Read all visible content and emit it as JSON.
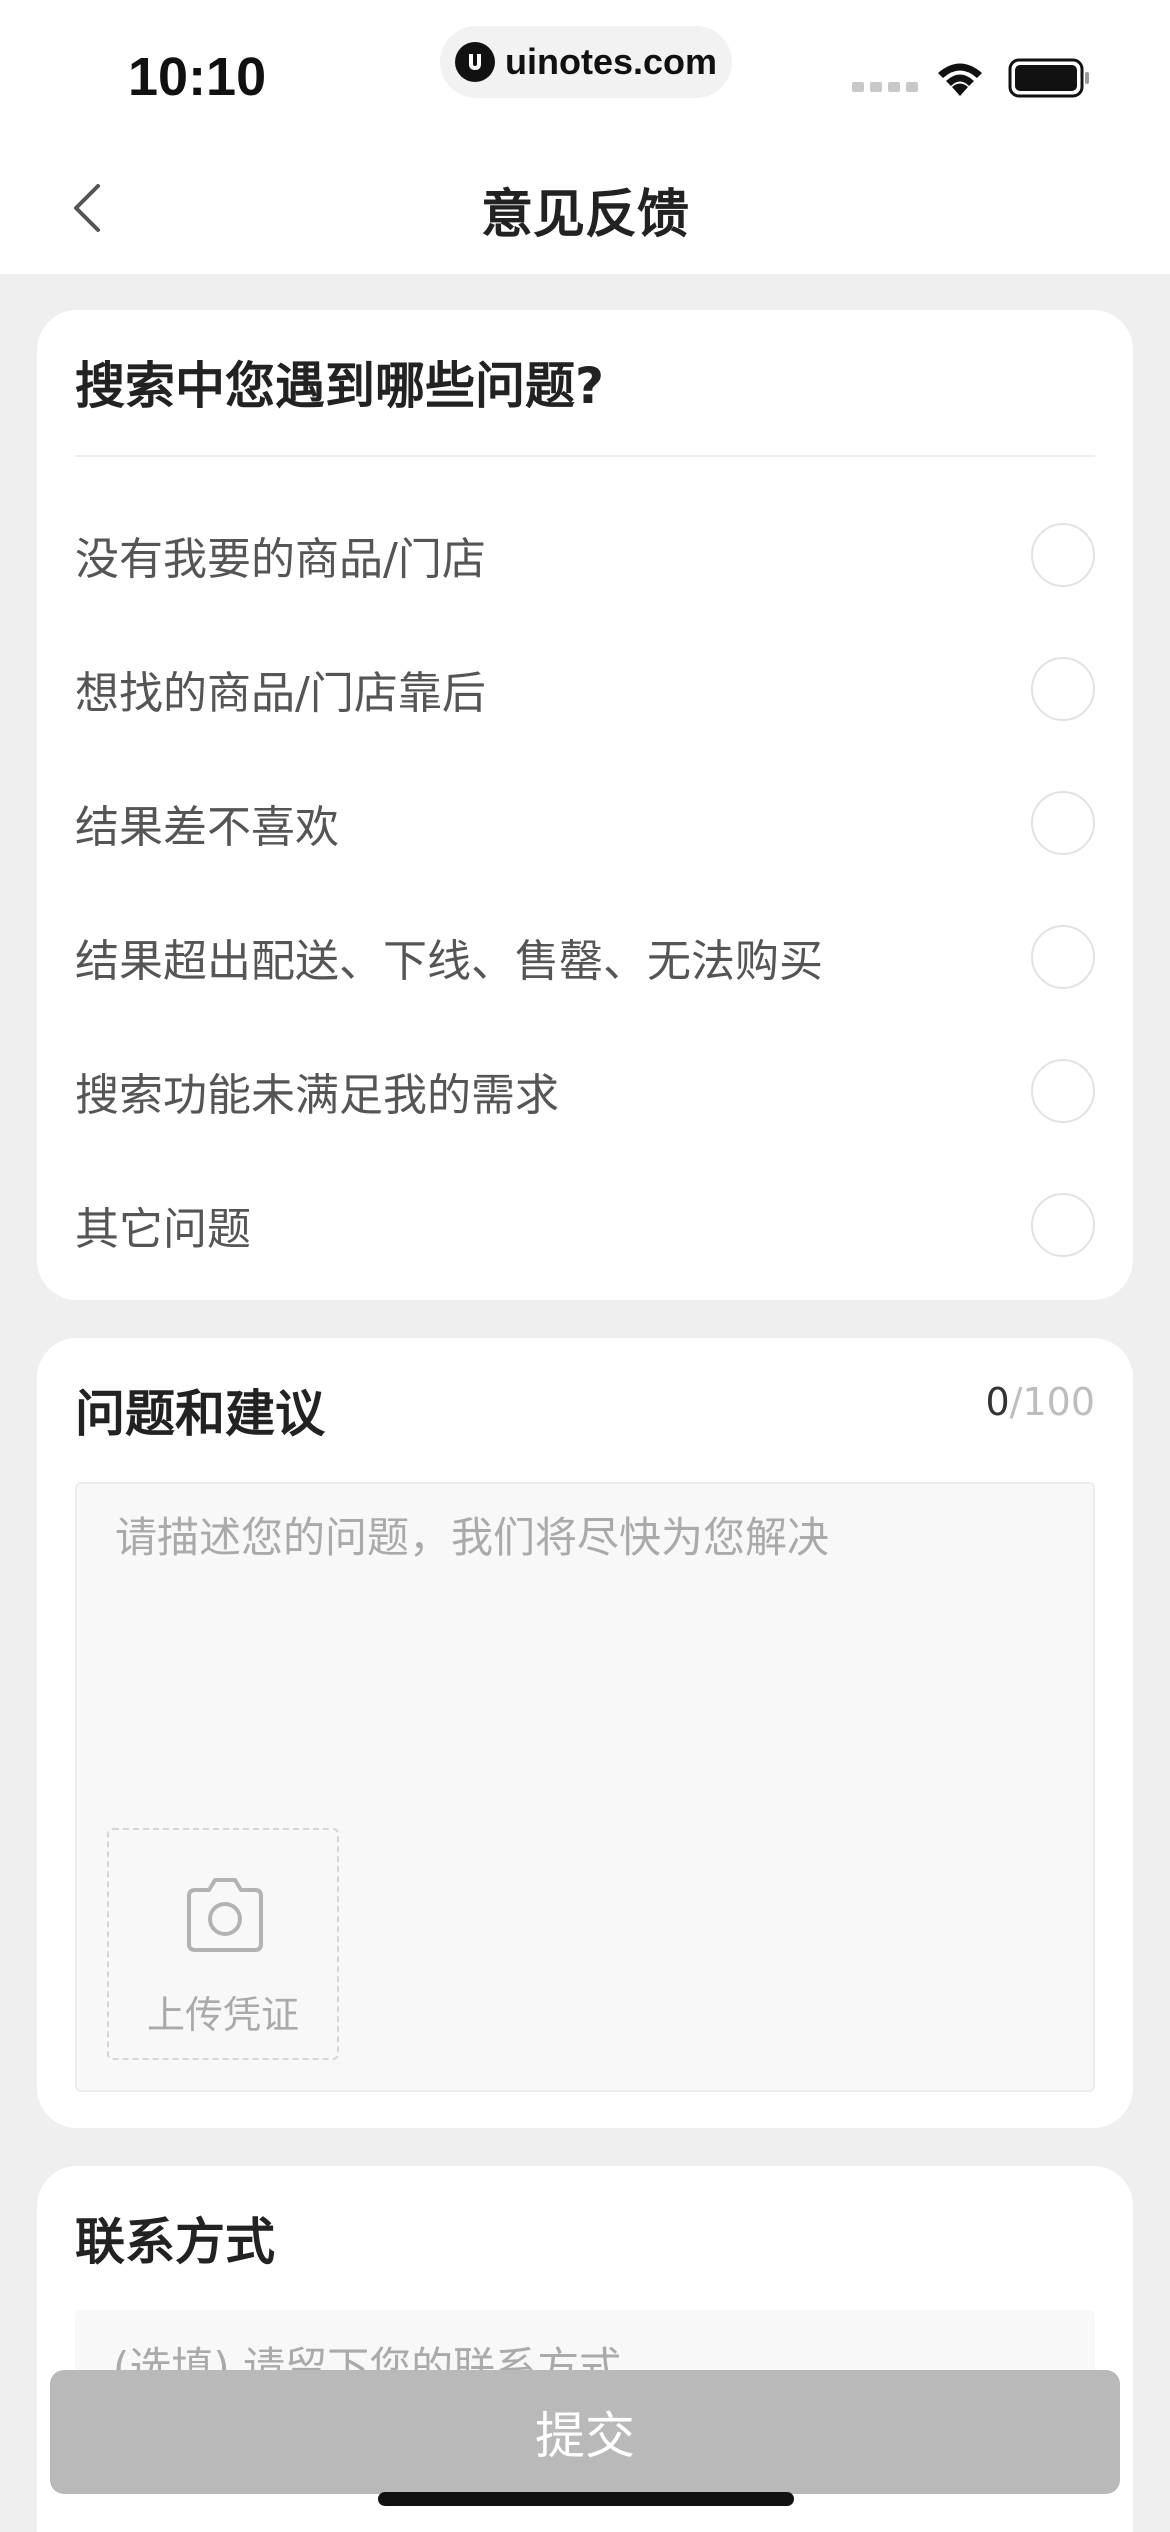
{
  "status_bar": {
    "time": "10:10",
    "url": "uinotes.com"
  },
  "nav": {
    "title": "意见反馈",
    "back_icon": "chevron-left-icon"
  },
  "issues": {
    "title": "搜索中您遇到哪些问题?",
    "options": [
      {
        "label": "没有我要的商品/门店",
        "selected": false
      },
      {
        "label": "想找的商品/门店靠后",
        "selected": false
      },
      {
        "label": "结果差不喜欢",
        "selected": false
      },
      {
        "label": "结果超出配送、下线、售罄、无法购买",
        "selected": false
      },
      {
        "label": "搜索功能未满足我的需求",
        "selected": false
      },
      {
        "label": "其它问题",
        "selected": false
      }
    ]
  },
  "suggest": {
    "title": "问题和建议",
    "count_current": "0",
    "count_max": "/100",
    "placeholder": "请描述您的问题，我们将尽快为您解决",
    "upload_label": "上传凭证",
    "upload_icon": "camera-icon"
  },
  "contact": {
    "title": "联系方式",
    "placeholder": "(选填) 请留下您的联系方式"
  },
  "submit": {
    "label": "提交"
  },
  "colors": {
    "page_bg": "#efefef",
    "submit_disabled": "#b9b9b9"
  }
}
